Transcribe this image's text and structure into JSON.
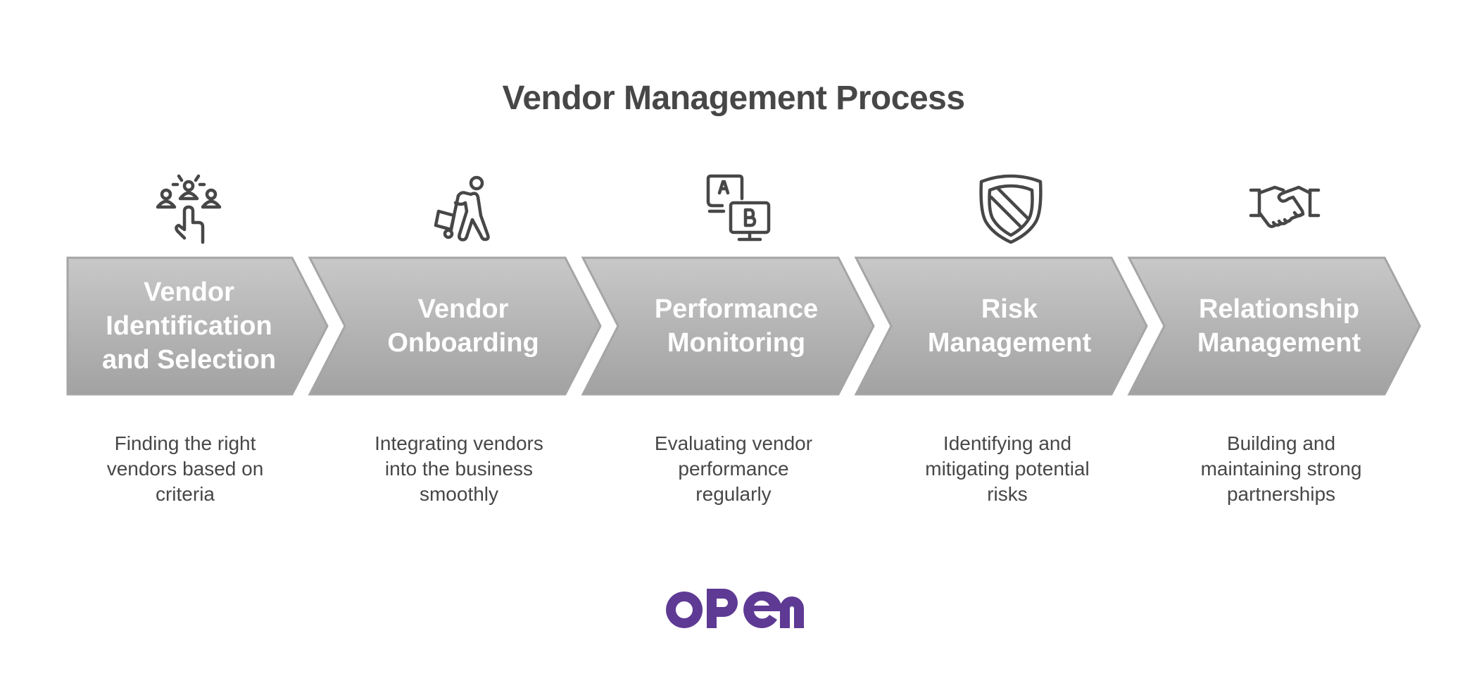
{
  "title": "Vendor Management Process",
  "colors": {
    "chevron_top": "#c8c8c8",
    "chevron_bottom": "#a2a2a2",
    "chevron_border": "#a5a5a5",
    "icon_stroke": "#474747",
    "text": "#474747",
    "brand": "#5e3a94"
  },
  "steps": [
    {
      "label_lines": [
        "Vendor",
        "Identification",
        "and Selection"
      ],
      "icon": "people-selection-icon",
      "description_lines": [
        "Finding the right",
        "vendors based on",
        "criteria"
      ]
    },
    {
      "label_lines": [
        "Vendor",
        "Onboarding"
      ],
      "icon": "person-pushing-cart-icon",
      "description_lines": [
        "Integrating vendors",
        "into the business",
        "smoothly"
      ]
    },
    {
      "label_lines": [
        "Performance",
        "Monitoring"
      ],
      "icon": "ab-test-monitor-icon",
      "description_lines": [
        "Evaluating vendor",
        "performance",
        "regularly"
      ]
    },
    {
      "label_lines": [
        "Risk",
        "Management"
      ],
      "icon": "shield-icon",
      "description_lines": [
        "Identifying and",
        "mitigating potential",
        "risks"
      ]
    },
    {
      "label_lines": [
        "Relationship",
        "Management"
      ],
      "icon": "handshake-icon",
      "description_lines": [
        "Building and",
        "maintaining strong",
        "partnerships"
      ]
    }
  ],
  "logo": {
    "text": "open",
    "icon": "open-logo"
  }
}
